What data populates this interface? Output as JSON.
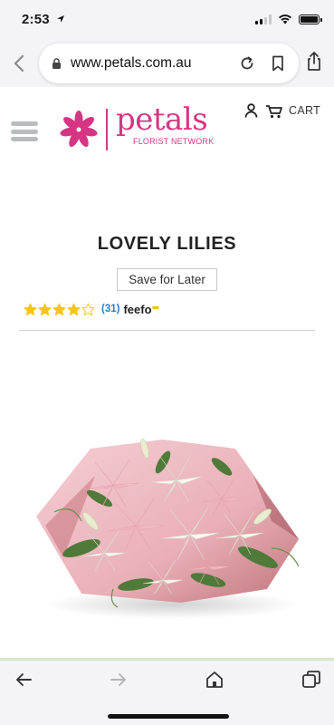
{
  "status_bar": {
    "time": "2:53"
  },
  "browser": {
    "url": "www.petals.com.au"
  },
  "site": {
    "logo_word": "petals",
    "logo_tag": "FLORIST NETWORK",
    "cart_label": "CART"
  },
  "product": {
    "title": "LOVELY LILIES",
    "save_label": "Save for Later",
    "rating_stars": 4,
    "review_count": "(31)",
    "rating_provider": "feefo"
  },
  "colors": {
    "brand": "#d63583",
    "star": "#f5c518",
    "link": "#2b7fc2"
  },
  "icons": {
    "status": [
      "location-arrow-icon",
      "signal-icon",
      "wifi-icon",
      "battery-icon"
    ],
    "browser": [
      "back-chevron-icon",
      "lock-icon",
      "reload-icon",
      "bookmark-icon",
      "share-icon"
    ],
    "toolbar": [
      "back-arrow-icon",
      "forward-arrow-icon",
      "home-icon",
      "tabs-icon"
    ]
  }
}
